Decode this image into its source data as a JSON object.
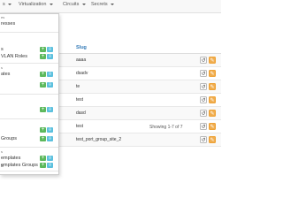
{
  "navbar": {
    "items": [
      {
        "label": "s"
      },
      {
        "label": "Virtualization"
      },
      {
        "label": "Circuits"
      },
      {
        "label": "Secrets"
      }
    ]
  },
  "dropdown": {
    "headers": [
      "es",
      "s",
      "s"
    ],
    "items": [
      {
        "label": "resses"
      },
      {
        "label": "s"
      },
      {
        "label": "VLAN Roles"
      },
      {
        "label": "ates"
      },
      {
        "label": "Groups"
      },
      {
        "label": "emplates"
      },
      {
        "label": "emplates Groups"
      },
      {
        "label": "s"
      }
    ],
    "button_icons": {
      "add": "plus-icon",
      "import": "import-icon"
    }
  },
  "table": {
    "column_header": "Slug",
    "rows": [
      {
        "slug": "aaaa"
      },
      {
        "slug": "dsadv"
      },
      {
        "slug": "te"
      },
      {
        "slug": "test"
      },
      {
        "slug": "dasd"
      },
      {
        "slug": "test"
      },
      {
        "slug": "test_port_group_site_2"
      }
    ],
    "row_buttons": {
      "history": "history-icon",
      "edit": "pencil-icon"
    },
    "showing_text": "Showing 1-7 of 7"
  },
  "colors": {
    "add_button": "#5cb85c",
    "import_button": "#5bc0de",
    "edit_button": "#f0ad4e",
    "link": "#337ab7"
  }
}
